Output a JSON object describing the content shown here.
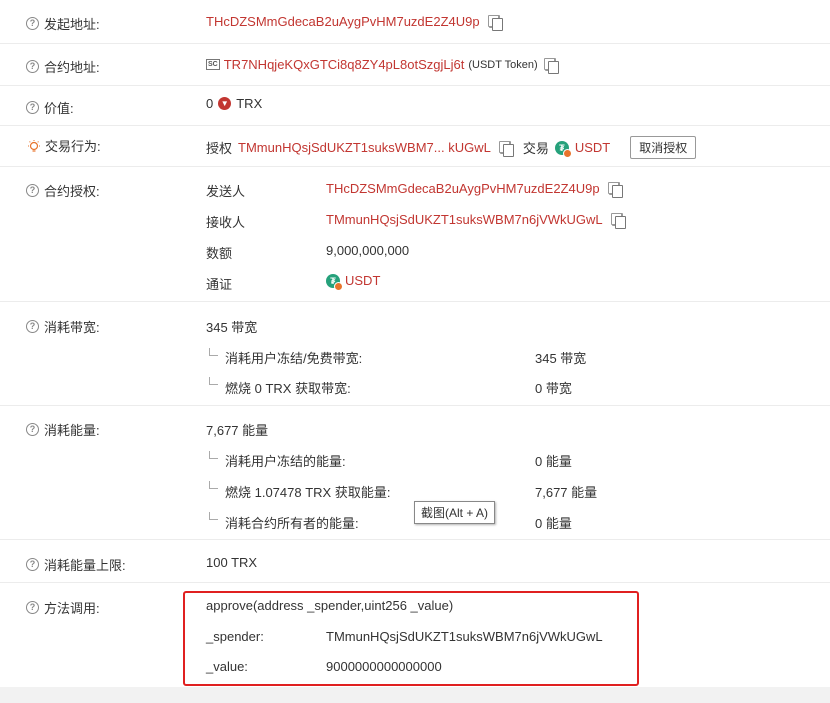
{
  "rows": {
    "from": {
      "label": "发起地址:",
      "address": "THcDZSMmGdecaB2uAygPvHM7uzdE2Z4U9p"
    },
    "contract": {
      "label": "合约地址:",
      "sc_badge": "SC",
      "address": "TR7NHqjeKQxGTCi8q8ZY4pL8otSzgjLj6t",
      "note": "(USDT Token)"
    },
    "value": {
      "label": "价值:",
      "amount": "0",
      "token": "TRX"
    },
    "action": {
      "label": "交易行为:",
      "auth_label": "授权",
      "spender": "TMmunHQsjSdUKZT1suksWBM7... kUGwL",
      "trade_label": "交易",
      "token": "USDT",
      "revoke_button": "取消授权"
    },
    "approval": {
      "label": "合约授权:",
      "sender_label": "发送人",
      "sender": "THcDZSMmGdecaB2uAygPvHM7uzdE2Z4U9p",
      "receiver_label": "接收人",
      "receiver": "TMmunHQsjSdUKZT1suksWBM7n6jVWkUGwL",
      "amount_label": "数额",
      "amount": "9,000,000,000",
      "token_label": "通证",
      "token": "USDT"
    },
    "bandwidth": {
      "label": "消耗带宽:",
      "total": "345 带宽",
      "items": [
        {
          "label": "消耗用户冻结/免费带宽:",
          "value": "345 带宽"
        },
        {
          "label": "燃烧 0 TRX 获取带宽:",
          "value": "0 带宽"
        }
      ]
    },
    "energy": {
      "label": "消耗能量:",
      "total": "7,677 能量",
      "items": [
        {
          "label": "消耗用户冻结的能量:",
          "value": "0 能量"
        },
        {
          "label": "燃烧 1.07478 TRX 获取能量:",
          "value": "7,677 能量"
        },
        {
          "label": "消耗合约所有者的能量:",
          "value": "0 能量"
        }
      ]
    },
    "fee_limit": {
      "label": "消耗能量上限:",
      "value": "100 TRX"
    },
    "method": {
      "label": "方法调用:",
      "signature": "approve(address _spender,uint256 _value)",
      "param1_name": "_spender:",
      "param1_value": "TMmunHQsjSdUKZT1suksWBM7n6jVWkUGwL",
      "param2_name": "_value:",
      "param2_value": "9000000000000000"
    }
  },
  "tooltip": "截图(Alt + A)",
  "colors": {
    "link": "#c23631",
    "highlight": "#e02020",
    "tether": "#26a17b"
  }
}
